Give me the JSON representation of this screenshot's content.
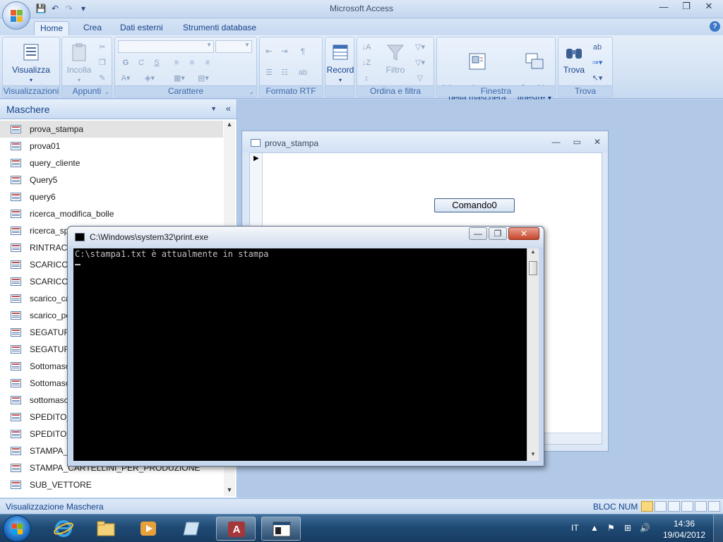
{
  "window": {
    "app_title": "Microsoft Access",
    "minimize": "—",
    "maximize": "❐",
    "close": "✕"
  },
  "qat": {
    "save_icon": "save-icon",
    "undo_icon": "undo-icon",
    "redo_icon": "redo-icon",
    "customize": "▾"
  },
  "ribbon": {
    "tabs": [
      "Home",
      "Crea",
      "Dati esterni",
      "Strumenti database"
    ],
    "active_tab": "Home",
    "help": "?",
    "groups": {
      "visualizzazioni": {
        "label": "Visualizzazioni",
        "button": "Visualizza"
      },
      "appunti": {
        "label": "Appunti",
        "button": "Incolla"
      },
      "carattere": {
        "label": "Carattere"
      },
      "formato_rtf": {
        "label": "Formato RTF"
      },
      "record": {
        "label": "",
        "button": "Record"
      },
      "ordina": {
        "label": "Ordina e filtra",
        "button": "Filtro"
      },
      "finestra": {
        "label": "Finestra",
        "adatta": "Adatta al contenuto\ndella maschera",
        "cambia": "Cambia\nfinestre ▾"
      },
      "trova": {
        "label": "Trova",
        "button": "Trova"
      }
    }
  },
  "navpane": {
    "title": "Maschere",
    "items": [
      "prova_stampa",
      "prova01",
      "query_cliente",
      "Query5",
      "query6",
      "ricerca_modifica_bolle",
      "ricerca_spe",
      "RINTRACCI",
      "SCARICO_",
      "SCARICO_",
      "scarico_ca",
      "scarico_pe",
      "SEGATURA",
      "SEGATURA",
      "Sottomasc",
      "Sottomasc",
      "sottomasc",
      "SPEDITO_F",
      "SPEDITO_F",
      "STAMPA_B",
      "STAMPA_CARTELLINI_PER_PRODUZIONE",
      "SUB_VETTORE"
    ],
    "selected_index": 0
  },
  "form_window": {
    "title": "prova_stampa",
    "button_label": "Comando0"
  },
  "console": {
    "title": "C:\\Windows\\system32\\print.exe",
    "output": "C:\\stampa1.txt è attualmente in stampa"
  },
  "statusbar": {
    "left": "Visualizzazione Maschera",
    "right": "BLOC NUM"
  },
  "taskbar": {
    "language": "IT",
    "time": "14:36",
    "date": "19/04/2012"
  },
  "colors": {
    "ribbon_text": "#15428b",
    "console_bg": "#000000",
    "taskbar": "#1f4a74"
  }
}
